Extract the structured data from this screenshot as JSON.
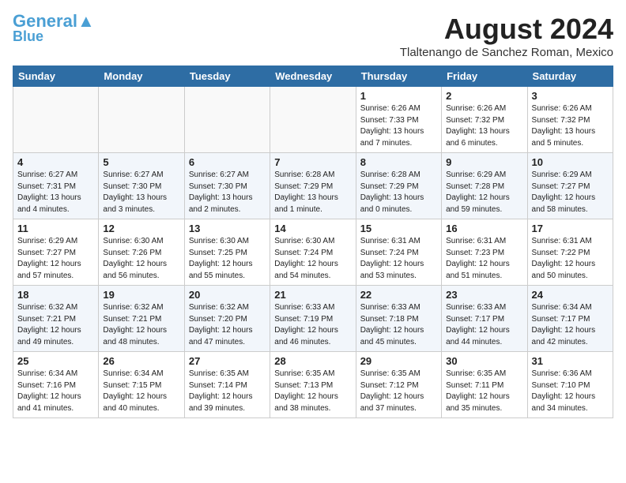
{
  "header": {
    "logo_line1": "General",
    "logo_line2": "Blue",
    "month_year": "August 2024",
    "location": "Tlaltenango de Sanchez Roman, Mexico"
  },
  "days_of_week": [
    "Sunday",
    "Monday",
    "Tuesday",
    "Wednesday",
    "Thursday",
    "Friday",
    "Saturday"
  ],
  "weeks": [
    [
      {
        "day": "",
        "info": ""
      },
      {
        "day": "",
        "info": ""
      },
      {
        "day": "",
        "info": ""
      },
      {
        "day": "",
        "info": ""
      },
      {
        "day": "1",
        "info": "Sunrise: 6:26 AM\nSunset: 7:33 PM\nDaylight: 13 hours\nand 7 minutes."
      },
      {
        "day": "2",
        "info": "Sunrise: 6:26 AM\nSunset: 7:32 PM\nDaylight: 13 hours\nand 6 minutes."
      },
      {
        "day": "3",
        "info": "Sunrise: 6:26 AM\nSunset: 7:32 PM\nDaylight: 13 hours\nand 5 minutes."
      }
    ],
    [
      {
        "day": "4",
        "info": "Sunrise: 6:27 AM\nSunset: 7:31 PM\nDaylight: 13 hours\nand 4 minutes."
      },
      {
        "day": "5",
        "info": "Sunrise: 6:27 AM\nSunset: 7:30 PM\nDaylight: 13 hours\nand 3 minutes."
      },
      {
        "day": "6",
        "info": "Sunrise: 6:27 AM\nSunset: 7:30 PM\nDaylight: 13 hours\nand 2 minutes."
      },
      {
        "day": "7",
        "info": "Sunrise: 6:28 AM\nSunset: 7:29 PM\nDaylight: 13 hours\nand 1 minute."
      },
      {
        "day": "8",
        "info": "Sunrise: 6:28 AM\nSunset: 7:29 PM\nDaylight: 13 hours\nand 0 minutes."
      },
      {
        "day": "9",
        "info": "Sunrise: 6:29 AM\nSunset: 7:28 PM\nDaylight: 12 hours\nand 59 minutes."
      },
      {
        "day": "10",
        "info": "Sunrise: 6:29 AM\nSunset: 7:27 PM\nDaylight: 12 hours\nand 58 minutes."
      }
    ],
    [
      {
        "day": "11",
        "info": "Sunrise: 6:29 AM\nSunset: 7:27 PM\nDaylight: 12 hours\nand 57 minutes."
      },
      {
        "day": "12",
        "info": "Sunrise: 6:30 AM\nSunset: 7:26 PM\nDaylight: 12 hours\nand 56 minutes."
      },
      {
        "day": "13",
        "info": "Sunrise: 6:30 AM\nSunset: 7:25 PM\nDaylight: 12 hours\nand 55 minutes."
      },
      {
        "day": "14",
        "info": "Sunrise: 6:30 AM\nSunset: 7:24 PM\nDaylight: 12 hours\nand 54 minutes."
      },
      {
        "day": "15",
        "info": "Sunrise: 6:31 AM\nSunset: 7:24 PM\nDaylight: 12 hours\nand 53 minutes."
      },
      {
        "day": "16",
        "info": "Sunrise: 6:31 AM\nSunset: 7:23 PM\nDaylight: 12 hours\nand 51 minutes."
      },
      {
        "day": "17",
        "info": "Sunrise: 6:31 AM\nSunset: 7:22 PM\nDaylight: 12 hours\nand 50 minutes."
      }
    ],
    [
      {
        "day": "18",
        "info": "Sunrise: 6:32 AM\nSunset: 7:21 PM\nDaylight: 12 hours\nand 49 minutes."
      },
      {
        "day": "19",
        "info": "Sunrise: 6:32 AM\nSunset: 7:21 PM\nDaylight: 12 hours\nand 48 minutes."
      },
      {
        "day": "20",
        "info": "Sunrise: 6:32 AM\nSunset: 7:20 PM\nDaylight: 12 hours\nand 47 minutes."
      },
      {
        "day": "21",
        "info": "Sunrise: 6:33 AM\nSunset: 7:19 PM\nDaylight: 12 hours\nand 46 minutes."
      },
      {
        "day": "22",
        "info": "Sunrise: 6:33 AM\nSunset: 7:18 PM\nDaylight: 12 hours\nand 45 minutes."
      },
      {
        "day": "23",
        "info": "Sunrise: 6:33 AM\nSunset: 7:17 PM\nDaylight: 12 hours\nand 44 minutes."
      },
      {
        "day": "24",
        "info": "Sunrise: 6:34 AM\nSunset: 7:17 PM\nDaylight: 12 hours\nand 42 minutes."
      }
    ],
    [
      {
        "day": "25",
        "info": "Sunrise: 6:34 AM\nSunset: 7:16 PM\nDaylight: 12 hours\nand 41 minutes."
      },
      {
        "day": "26",
        "info": "Sunrise: 6:34 AM\nSunset: 7:15 PM\nDaylight: 12 hours\nand 40 minutes."
      },
      {
        "day": "27",
        "info": "Sunrise: 6:35 AM\nSunset: 7:14 PM\nDaylight: 12 hours\nand 39 minutes."
      },
      {
        "day": "28",
        "info": "Sunrise: 6:35 AM\nSunset: 7:13 PM\nDaylight: 12 hours\nand 38 minutes."
      },
      {
        "day": "29",
        "info": "Sunrise: 6:35 AM\nSunset: 7:12 PM\nDaylight: 12 hours\nand 37 minutes."
      },
      {
        "day": "30",
        "info": "Sunrise: 6:35 AM\nSunset: 7:11 PM\nDaylight: 12 hours\nand 35 minutes."
      },
      {
        "day": "31",
        "info": "Sunrise: 6:36 AM\nSunset: 7:10 PM\nDaylight: 12 hours\nand 34 minutes."
      }
    ]
  ]
}
